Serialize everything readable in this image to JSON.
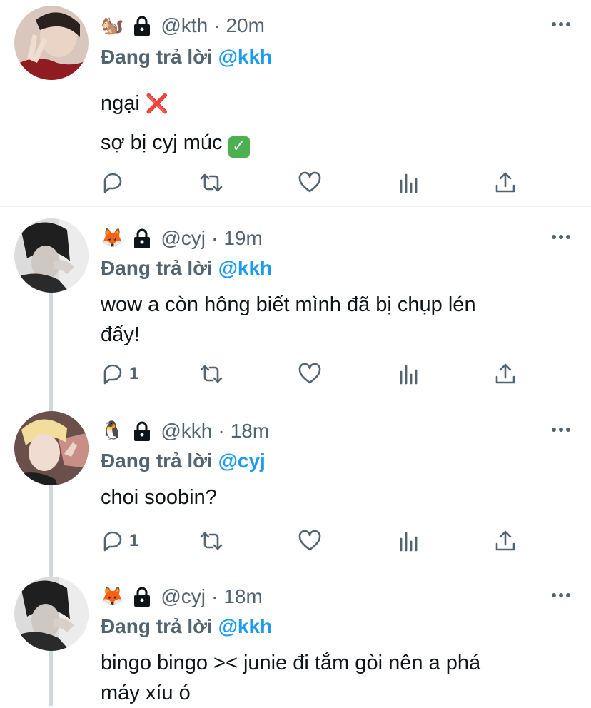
{
  "colors": {
    "accent": "#1d9bf0",
    "muted": "#536471",
    "text": "#0f1419",
    "thread": "#cfd9de"
  },
  "tweets": [
    {
      "emoji": "🐿️",
      "handle": "@kth",
      "sep": "·",
      "time": "20m",
      "reply_prefix": "Đang trả lời",
      "reply_to": "@kkh",
      "lines": [
        "ngại",
        "sợ bị cyj múc"
      ],
      "line_marks": [
        "❌",
        "✓"
      ],
      "reply_count": ""
    },
    {
      "emoji": "🦊",
      "handle": "@cyj",
      "sep": "·",
      "time": "19m",
      "reply_prefix": "Đang trả lời",
      "reply_to": "@kkh",
      "lines": [
        "wow a còn hông biết mình đã bị chụp lén",
        "đấy!"
      ],
      "reply_count": "1"
    },
    {
      "emoji": "🐧",
      "handle": "@kkh",
      "sep": "·",
      "time": "18m",
      "reply_prefix": "Đang trả lời",
      "reply_to": "@cyj",
      "lines": [
        "choi soobin?"
      ],
      "reply_count": "1"
    },
    {
      "emoji": "🦊",
      "handle": "@cyj",
      "sep": "·",
      "time": "18m",
      "reply_prefix": "Đang trả lời",
      "reply_to": "@kkh",
      "lines": [
        "bingo bingo >< junie đi tắm gòi nên a phá",
        "máy xíu ó"
      ]
    }
  ]
}
